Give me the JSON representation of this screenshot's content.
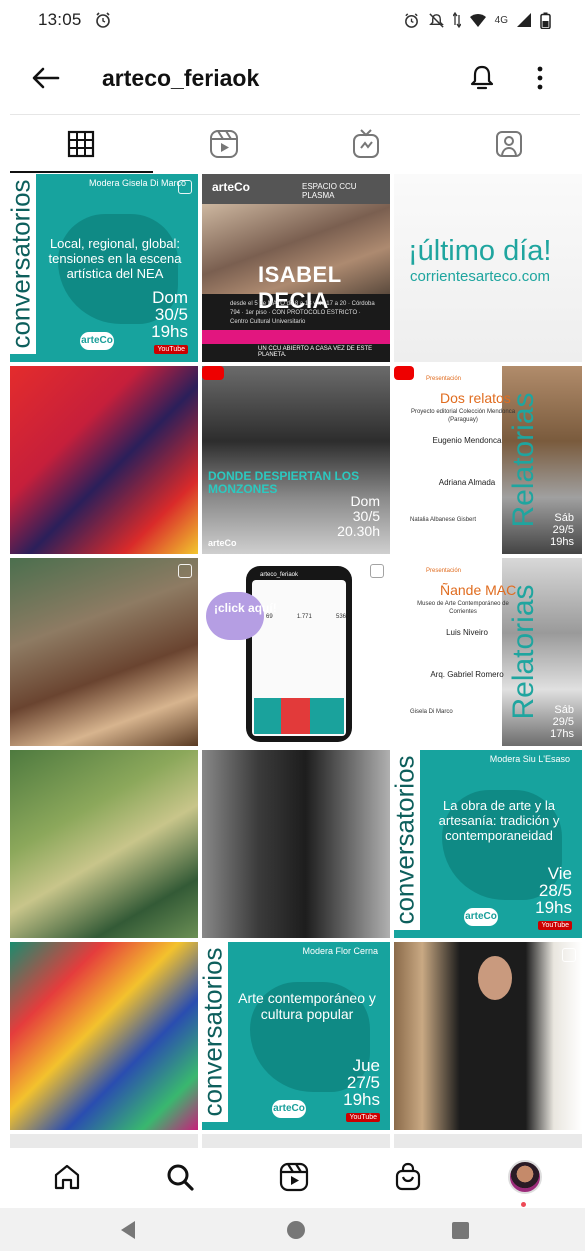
{
  "status_bar": {
    "time": "13:05",
    "network_label": "4G"
  },
  "header": {
    "title": "arteco_feriaok"
  },
  "tabs": [
    {
      "name": "posts",
      "icon": "grid-icon",
      "active": true
    },
    {
      "name": "reels",
      "icon": "reels-icon",
      "active": false
    },
    {
      "name": "igtv",
      "icon": "igtv-icon",
      "active": false
    },
    {
      "name": "tagged",
      "icon": "tagged-user-icon",
      "active": false
    }
  ],
  "posts": {
    "p1": {
      "vertical": "conversatorios",
      "moderator": "Modera Gisela Di Marco",
      "headline": "Local, regional, global: tensiones en la escena artística del NEA",
      "date": "Dom\n30/5\n19hs",
      "platform": "YouTube",
      "logo": "arteCo"
    },
    "p2": {
      "logo": "arteCo",
      "header": "ESPACIO CCU PLASMA",
      "name": "ISABEL DECIA",
      "info": "desde el 5 de MAYO de 8 a 13 y de 17 a 20 · Córdoba 794 · 1er piso · CON PROTOCOLO ESTRICTO · Centro Cultural Universitario",
      "footer": "UN CCU ABIERTO A CASA VEZ DE ESTE PLANETA."
    },
    "p3": {
      "title": "¡último día!",
      "url": "corrientesarteco.com"
    },
    "p4": {},
    "p5": {
      "overlay": "DONDE DESPIERTAN LOS MONZONES",
      "date": "Dom\n30/5\n20.30h",
      "logo": "arteCo"
    },
    "p6": {
      "presentation": "Presentación",
      "title": "Dos relatos",
      "subtitle": "Proyecto editorial Colección Mendonca (Paraguay)",
      "person1": "Eugenio Mendonca",
      "person2": "Adriana Almada",
      "presenter": "Natalia Albanese Gisbert",
      "vertical": "Relatorias",
      "date": "Sáb\n29/5\n19hs"
    },
    "p7": {},
    "p8": {
      "bubble": "¡click aquí!",
      "username": "arteco_feriaok",
      "stats": [
        "69",
        "1.771",
        "536"
      ]
    },
    "p9": {
      "presentation": "Presentación",
      "title": "Ñande MAC",
      "subtitle": "Museo de Arte Contemporáneo de Corrientes",
      "person1": "Luis Niveiro",
      "person2": "Arq. Gabriel Romero",
      "presenter": "Gisela Di Marco",
      "vertical": "Relatorias",
      "date": "Sáb\n29/5\n17hs"
    },
    "p10": {},
    "p11": {},
    "p12": {
      "vertical": "conversatorios",
      "moderator": "Modera Siu L'Esaso",
      "headline": "La obra de arte y la artesanía: tradición y contemporaneidad",
      "date": "Vie\n28/5\n19hs",
      "platform": "YouTube",
      "logo": "arteCo"
    },
    "p13": {},
    "p14": {
      "vertical": "conversatorios",
      "moderator": "Modera Flor Cerna",
      "headline": "Arte contemporáneo y cultura popular",
      "date": "Jue\n27/5\n19hs",
      "platform": "YouTube",
      "logo": "arteCo"
    },
    "p15": {}
  },
  "bottom_nav": [
    {
      "name": "home",
      "icon": "home-icon"
    },
    {
      "name": "search",
      "icon": "search-icon"
    },
    {
      "name": "reels",
      "icon": "reels-icon"
    },
    {
      "name": "shop",
      "icon": "shop-bag-icon"
    },
    {
      "name": "profile",
      "icon": "avatar"
    }
  ],
  "colors": {
    "accent_teal": "#17a39e",
    "notification_dot": "#ed4956"
  }
}
